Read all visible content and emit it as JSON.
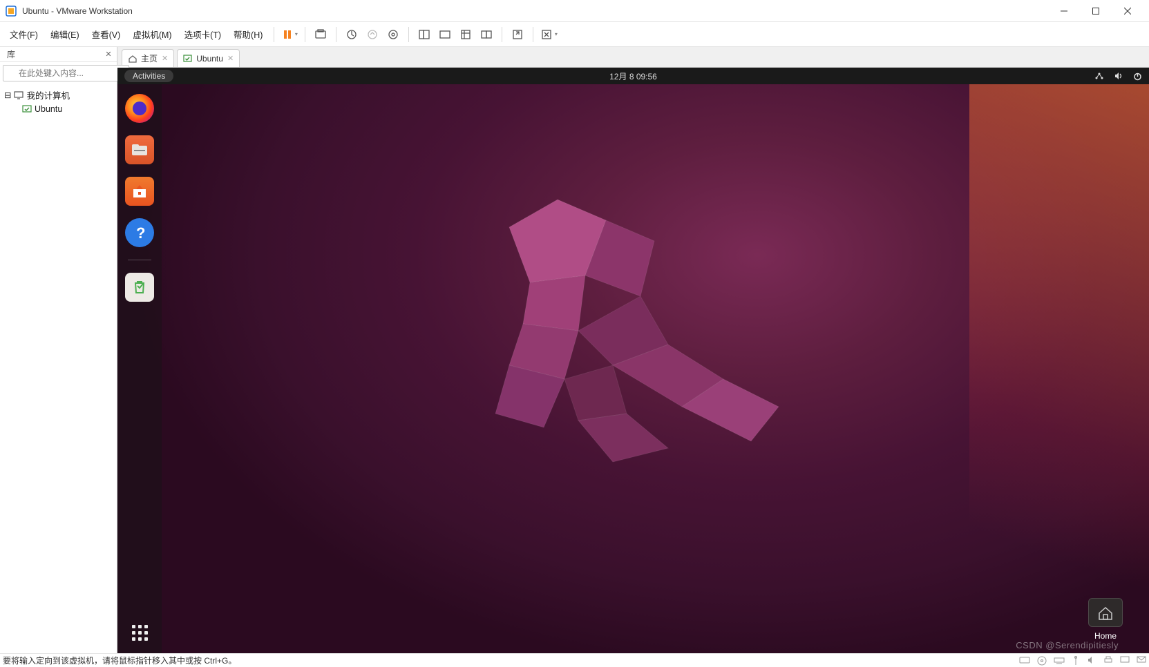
{
  "window": {
    "title": "Ubuntu - VMware Workstation"
  },
  "menu": {
    "file": "文件(F)",
    "edit": "编辑(E)",
    "view": "查看(V)",
    "vm": "虚拟机(M)",
    "tabs": "选项卡(T)",
    "help": "帮助(H)"
  },
  "sidebar": {
    "title": "库",
    "search_placeholder": "在此处键入内容...",
    "root": "我的计算机",
    "child": "Ubuntu"
  },
  "tabs": {
    "home": "主页",
    "vm": "Ubuntu"
  },
  "gnome": {
    "activities": "Activities",
    "clock": "12月 8  09:56",
    "home_label": "Home"
  },
  "status": {
    "hint": "要将输入定向到该虚拟机，请将鼠标指针移入其中或按 Ctrl+G。"
  },
  "watermark": "CSDN @Serendipitiesly"
}
